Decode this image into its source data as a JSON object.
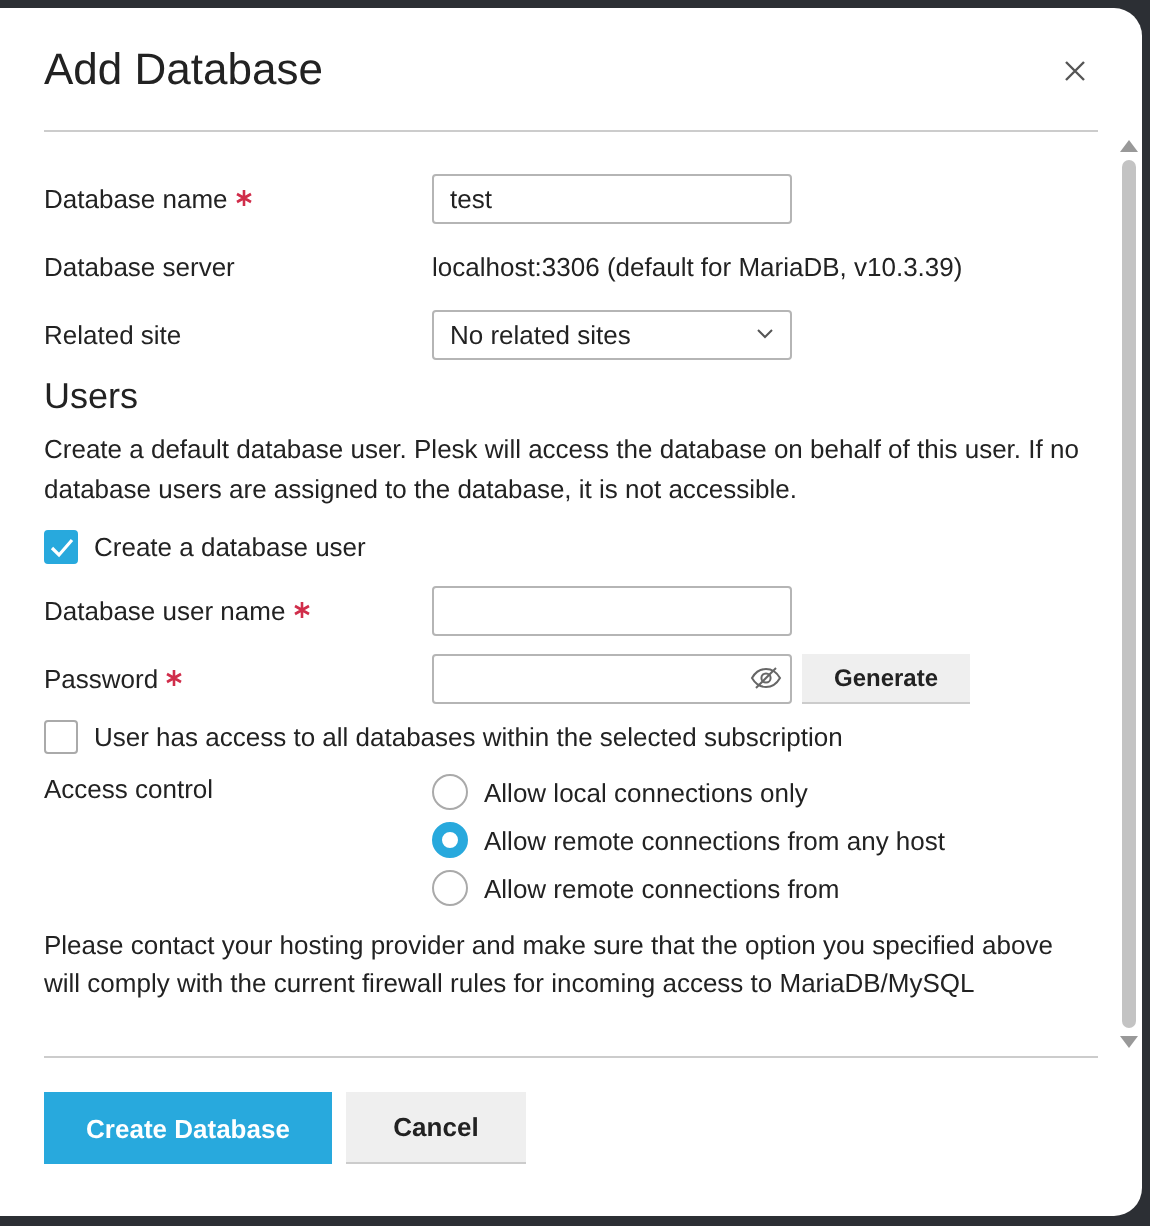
{
  "dialog": {
    "title": "Add Database"
  },
  "fields": [
    {
      "kind": "input",
      "label": "Database name",
      "required": true,
      "value": "test"
    },
    {
      "kind": "text",
      "label": "Database server",
      "value": "localhost:3306 (default for MariaDB, v10.3.39)"
    },
    {
      "kind": "select",
      "label": "Related site",
      "value": "No related sites"
    }
  ],
  "users": {
    "heading": "Users",
    "description": "Create a default database user. Plesk will access the database on behalf of this user. If no database users are assigned to the database, it is not accessible.",
    "create_user": {
      "label": "Create a database user",
      "checked": true
    },
    "fields": [
      {
        "kind": "input",
        "label": "Database user name",
        "required": true
      },
      {
        "kind": "password",
        "label": "Password",
        "required": true,
        "button": "Generate"
      }
    ],
    "all_access": {
      "label": "User has access to all databases within the selected subscription",
      "checked": false
    },
    "access_control": {
      "label": "Access control",
      "options": [
        {
          "label": "Allow local connections only",
          "selected": false
        },
        {
          "label": "Allow remote connections from any host",
          "selected": true
        },
        {
          "label": "Allow remote connections from",
          "selected": false
        }
      ]
    },
    "note": "Please contact your hosting provider and make sure that the option you specified above will comply with the current firewall rules for incoming access to MariaDB/MySQL"
  },
  "buttons": [
    {
      "label": "Create Database",
      "kind": "primary"
    },
    {
      "label": "Cancel",
      "kind": "secondary"
    }
  ]
}
